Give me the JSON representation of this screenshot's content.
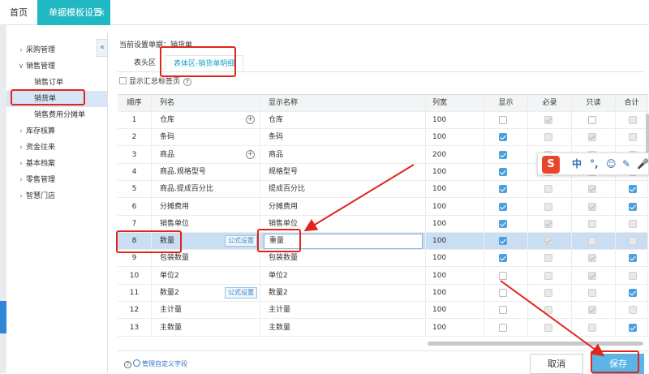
{
  "tabs": {
    "home": "首页",
    "active": "单据模板设置",
    "close_glyph": "×"
  },
  "sidebar": {
    "collapse_glyph": "«",
    "groups": [
      {
        "label": "采购管理",
        "expanded": false
      },
      {
        "label": "销售管理",
        "expanded": true
      },
      {
        "label": "库存核算",
        "expanded": false
      },
      {
        "label": "资金往来",
        "expanded": false
      },
      {
        "label": "基本档案",
        "expanded": false
      },
      {
        "label": "零售管理",
        "expanded": false
      },
      {
        "label": "智慧门店",
        "expanded": false
      }
    ],
    "sales_items": [
      "销售订单",
      "销货单",
      "销售费用分摊单"
    ],
    "active_item": "销货单"
  },
  "crumb": "当前设置单据：销货单",
  "subtabs": [
    "表头区",
    "表体区-销货单明细"
  ],
  "option": {
    "label": "显示汇总标签页",
    "help": "?"
  },
  "table": {
    "headers": [
      "顺序",
      "列名",
      "显示名称",
      "列宽",
      "显示",
      "必录",
      "只读",
      "合计"
    ],
    "rows": [
      {
        "idx": "1",
        "name": "仓库",
        "plus": true,
        "disp": "仓库",
        "width": "100",
        "show": "off",
        "req": "dison",
        "ro": "off",
        "sum": "dis"
      },
      {
        "idx": "2",
        "name": "条码",
        "disp": "条码",
        "width": "100",
        "show": "on",
        "req": "dis",
        "ro": "dison",
        "sum": "dis"
      },
      {
        "idx": "3",
        "name": "商品",
        "plus": true,
        "disp": "商品",
        "width": "200",
        "show": "on",
        "req": "dison",
        "ro": "dis",
        "sum": "dis"
      },
      {
        "idx": "4",
        "name": "商品.规格型号",
        "disp": "规格型号",
        "width": "100",
        "show": "on",
        "req": "dis",
        "ro": "dison",
        "sum": "dis"
      },
      {
        "idx": "5",
        "name": "商品.提成百分比",
        "disp": "提成百分比",
        "width": "100",
        "show": "on",
        "req": "dis",
        "ro": "dison",
        "sum": "on"
      },
      {
        "idx": "6",
        "name": "分摊费用",
        "disp": "分摊费用",
        "width": "100",
        "show": "on",
        "req": "dis",
        "ro": "dison",
        "sum": "on"
      },
      {
        "idx": "7",
        "name": "销售单位",
        "disp": "销售单位",
        "width": "100",
        "show": "on",
        "req": "dison",
        "ro": "dis",
        "sum": "dis"
      },
      {
        "idx": "8",
        "name": "数量",
        "formula": "公式设置",
        "disp": "重量",
        "editing": true,
        "width": "100",
        "show": "on",
        "req": "dison",
        "ro": "dis",
        "sum": "dis",
        "selected": true
      },
      {
        "idx": "9",
        "name": "包装数量",
        "disp": "包装数量",
        "width": "100",
        "show": "on",
        "req": "dis",
        "ro": "dison",
        "sum": "on"
      },
      {
        "idx": "10",
        "name": "单位2",
        "disp": "单位2",
        "width": "100",
        "show": "off",
        "req": "dis",
        "ro": "dison",
        "sum": "dis"
      },
      {
        "idx": "11",
        "name": "数量2",
        "formula": "公式设置",
        "disp": "数量2",
        "width": "100",
        "show": "off",
        "req": "dis",
        "ro": "dis",
        "sum": "on"
      },
      {
        "idx": "12",
        "name": "主计量",
        "disp": "主计量",
        "width": "100",
        "show": "off",
        "req": "dis",
        "ro": "dison",
        "sum": "dis"
      },
      {
        "idx": "13",
        "name": "主数量",
        "disp": "主数量",
        "width": "100",
        "show": "off",
        "req": "dis",
        "ro": "dis",
        "sum": "on"
      }
    ]
  },
  "footer": {
    "help_glyph": "?",
    "link": "管理自定义字段",
    "cancel": "取消",
    "save": "保存"
  },
  "ime": {
    "logo": "S",
    "glyphs": [
      "中",
      "°,",
      "☺",
      "✎",
      "🎤"
    ]
  },
  "colors": {
    "accent": "#1fb8c3",
    "selected_row": "#c9def3",
    "annotation": "#e0261b",
    "save_button": "#5cb4e6"
  }
}
